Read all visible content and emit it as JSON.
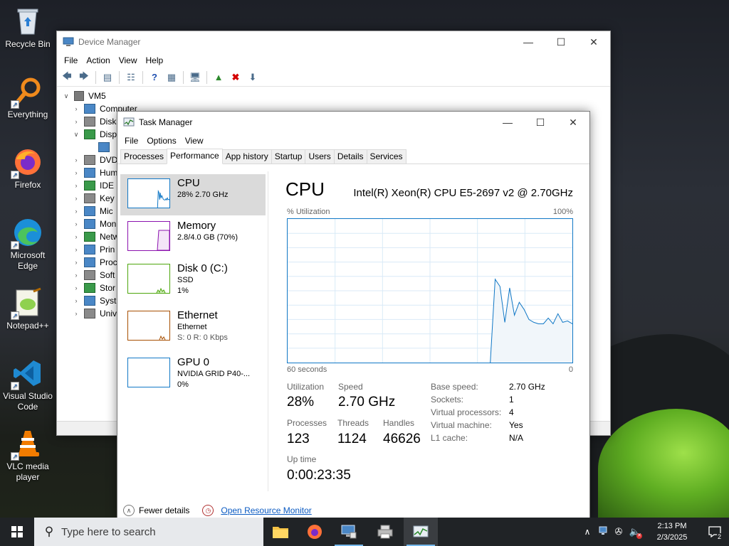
{
  "desktop": {
    "icons": [
      {
        "label": "Recycle Bin",
        "icon": "recycle-bin-icon"
      },
      {
        "label": "Everything",
        "icon": "everything-icon"
      },
      {
        "label": "Firefox",
        "icon": "firefox-icon"
      },
      {
        "label": "Microsoft Edge",
        "icon": "edge-icon"
      },
      {
        "label": "Notepad++",
        "icon": "notepadpp-icon"
      },
      {
        "label": "Visual Studio Code",
        "icon": "vscode-icon"
      },
      {
        "label": "VLC media player",
        "icon": "vlc-icon"
      }
    ]
  },
  "device_manager": {
    "title": "Device Manager",
    "menu": [
      "File",
      "Action",
      "View",
      "Help"
    ],
    "tree_root": "VM5",
    "tree_items": [
      "Computer",
      "Disk",
      "Disp",
      "",
      "DVD",
      "Hum",
      "IDE",
      "Key",
      "Mic",
      "Mon",
      "Netw",
      "Prin",
      "Proc",
      "Soft",
      "Stor",
      "Syst",
      "Univ"
    ]
  },
  "task_manager": {
    "title": "Task Manager",
    "menu": [
      "File",
      "Options",
      "View"
    ],
    "tabs": [
      "Processes",
      "Performance",
      "App history",
      "Startup",
      "Users",
      "Details",
      "Services"
    ],
    "active_tab": "Performance",
    "side": [
      {
        "name": "CPU",
        "sub1": "28% 2.70 GHz",
        "sub2": ""
      },
      {
        "name": "Memory",
        "sub1": "2.8/4.0 GB (70%)",
        "sub2": ""
      },
      {
        "name": "Disk 0 (C:)",
        "sub1": "SSD",
        "sub2": "1%"
      },
      {
        "name": "Ethernet",
        "sub1": "Ethernet",
        "sub2": "S: 0 R: 0 Kbps"
      },
      {
        "name": "GPU 0",
        "sub1": "NVIDIA GRID P40-...",
        "sub2": "0%"
      }
    ],
    "detail": {
      "title": "CPU",
      "model": "Intel(R) Xeon(R) CPU E5-2697 v2 @ 2.70GHz",
      "graph_label": "% Utilization",
      "graph_max": "100%",
      "graph_time": "60 seconds",
      "graph_zero": "0",
      "utilization_label": "Utilization",
      "utilization": "28%",
      "speed_label": "Speed",
      "speed": "2.70 GHz",
      "processes_label": "Processes",
      "processes": "123",
      "threads_label": "Threads",
      "threads": "1124",
      "handles_label": "Handles",
      "handles": "46626",
      "uptime_label": "Up time",
      "uptime": "0:00:23:35",
      "specs": [
        {
          "key": "Base speed:",
          "value": "2.70 GHz"
        },
        {
          "key": "Sockets:",
          "value": "1"
        },
        {
          "key": "Virtual processors:",
          "value": "4"
        },
        {
          "key": "Virtual machine:",
          "value": "Yes"
        },
        {
          "key": "L1 cache:",
          "value": "N/A"
        }
      ]
    },
    "footer": {
      "fewer_details": "Fewer details",
      "resource_monitor": "Open Resource Monitor"
    },
    "cpu_graph_series": [
      0,
      0,
      0,
      0,
      0,
      0,
      0,
      0,
      0,
      0,
      0,
      0,
      0,
      0,
      0,
      0,
      0,
      0,
      0,
      0,
      0,
      0,
      0,
      0,
      0,
      0,
      0,
      0,
      0,
      0,
      0,
      0,
      0,
      0,
      0,
      0,
      0,
      0,
      0,
      0,
      0,
      0,
      0,
      58,
      53,
      28,
      52,
      33,
      42,
      37,
      30,
      28,
      27,
      27,
      31,
      27,
      34,
      28,
      29,
      27
    ],
    "memory_graph_level": 0.7
  },
  "taskbar": {
    "search_placeholder": "Type here to search",
    "time": "2:13 PM",
    "date": "2/3/2025",
    "notification_count": "2"
  },
  "colors": {
    "accent": "#1178c6",
    "memory": "#8b12ae",
    "disk": "#4da60c",
    "ethernet": "#a74f01"
  }
}
